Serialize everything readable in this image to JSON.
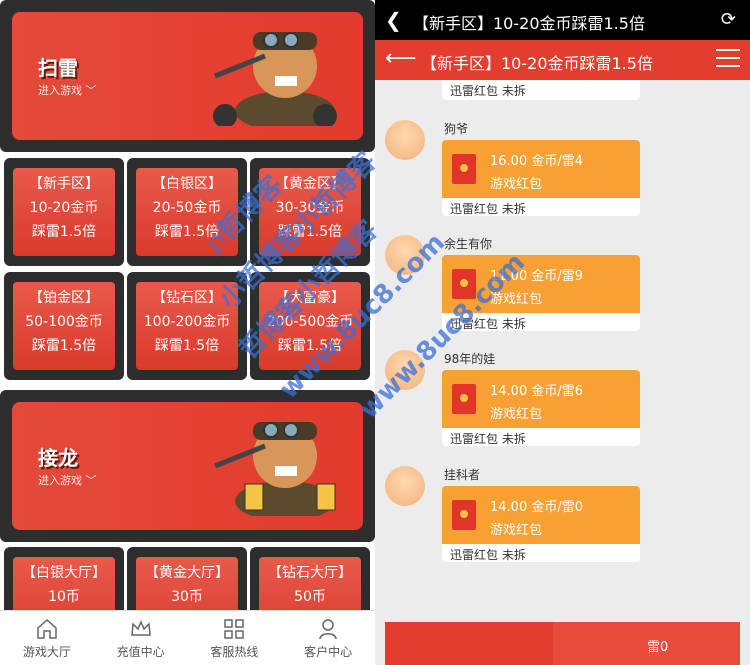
{
  "left": {
    "banners": [
      {
        "title": "扫雷",
        "sub": "进入游戏 ﹀"
      },
      {
        "title": "接龙",
        "sub": "进入游戏 ﹀"
      }
    ],
    "zones": [
      {
        "name": "【新手区】",
        "range": "10-20金币",
        "rate": "踩雷1.5倍"
      },
      {
        "name": "【白银区】",
        "range": "20-50金币",
        "rate": "踩雷1.5倍"
      },
      {
        "name": "【黄金区】",
        "range": "30-30金币",
        "rate": "踩雷1.5倍"
      },
      {
        "name": "【铂金区】",
        "range": "50-100金币",
        "rate": "踩雷1.5倍"
      },
      {
        "name": "【钻石区】",
        "range": "100-200金币",
        "rate": "踩雷1.5倍"
      },
      {
        "name": "【大富豪】",
        "range": "200-500金币",
        "rate": "踩雷1.5倍"
      }
    ],
    "halls": [
      {
        "name": "【白银大厅】",
        "coins": "10币"
      },
      {
        "name": "【黄金大厅】",
        "coins": "30币"
      },
      {
        "name": "【钻石大厅】",
        "coins": "50币"
      }
    ],
    "tabs": [
      "游戏大厅",
      "充值中心",
      "客服热线",
      "客户中心"
    ]
  },
  "right": {
    "topbar_title": "【新手区】10-20金币踩雷1.5倍",
    "header_title": "【新手区】10-20金币踩雷1.5倍",
    "prev_footer": "迅雷红包 未拆",
    "messages": [
      {
        "nick": "狗爷",
        "line1": "16.00 金币/雷4",
        "line2": "游戏红包",
        "footer": "迅雷红包 未拆"
      },
      {
        "nick": "余生有你",
        "line1": "11.00 金币/雷9",
        "line2": "游戏红包",
        "footer": "迅雷红包 未拆"
      },
      {
        "nick": "98年的娃",
        "line1": "14.00 金币/雷6",
        "line2": "游戏红包",
        "footer": "迅雷红包 未拆"
      },
      {
        "nick": "挂科者",
        "line1": "14.00 金币/雷0",
        "line2": "游戏红包",
        "footer": "迅雷红包 未拆"
      }
    ],
    "bottom_partial": "雷0"
  },
  "watermark": [
    "小哲博客",
    "小哲博客小哲博客",
    "哲博客小哲博客",
    "www.8uc8.com",
    "www.8uc8.com"
  ],
  "colors": {
    "accent": "#e23d2f",
    "packet": "#f7a033"
  }
}
